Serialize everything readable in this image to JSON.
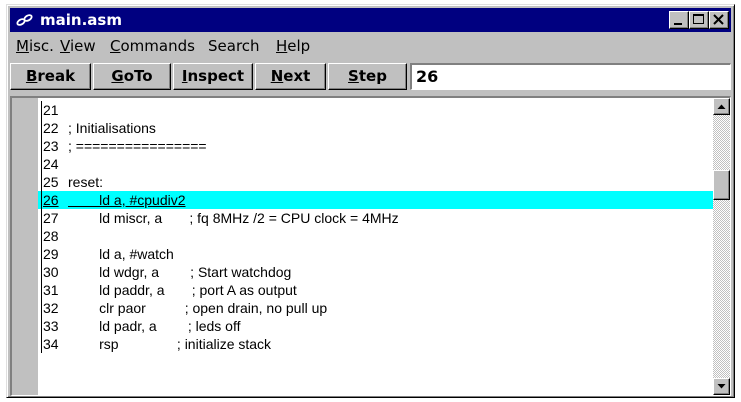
{
  "window": {
    "title": "main.asm",
    "icon": "link-chain-icon"
  },
  "menubar": {
    "items": [
      {
        "prefix": "",
        "underline": "M",
        "rest": "isc."
      },
      {
        "prefix": "",
        "underline": "V",
        "rest": "iew"
      },
      {
        "prefix": "",
        "underline": "C",
        "rest": "ommands"
      },
      {
        "prefix": "Search",
        "underline": "",
        "rest": ""
      },
      {
        "prefix": "",
        "underline": "H",
        "rest": "elp"
      }
    ]
  },
  "toolbar": {
    "buttons": [
      {
        "underline": "B",
        "rest": "reak"
      },
      {
        "underline": "G",
        "rest": "oTo"
      },
      {
        "underline": "I",
        "rest": "nspect"
      },
      {
        "underline": "N",
        "rest": "ext"
      },
      {
        "underline": "S",
        "rest": "tep"
      }
    ],
    "goto_value": "26"
  },
  "code": {
    "current_line": "26",
    "lines": [
      {
        "num": "21",
        "text": ""
      },
      {
        "num": "22",
        "text": "; Initialisations"
      },
      {
        "num": "23",
        "text": "; ================"
      },
      {
        "num": "24",
        "text": ""
      },
      {
        "num": "25",
        "text": "reset:"
      },
      {
        "num": "26",
        "text": "        ld a, #cpudiv2"
      },
      {
        "num": "27",
        "text": "        ld miscr, a       ; fq 8MHz /2 = CPU clock = 4MHz"
      },
      {
        "num": "28",
        "text": ""
      },
      {
        "num": "29",
        "text": "        ld a, #watch"
      },
      {
        "num": "30",
        "text": "        ld wdgr, a        ; Start watchdog"
      },
      {
        "num": "31",
        "text": "        ld paddr, a       ; port A as output"
      },
      {
        "num": "32",
        "text": "        clr paor          ; open drain, no pull up"
      },
      {
        "num": "33",
        "text": "        ld padr, a        ; leds off"
      },
      {
        "num": "34",
        "text": "        rsp               ; initialize stack"
      }
    ]
  },
  "colors": {
    "titlebar": "#000080",
    "highlight": "#00ffff",
    "face": "#c0c0c0"
  }
}
